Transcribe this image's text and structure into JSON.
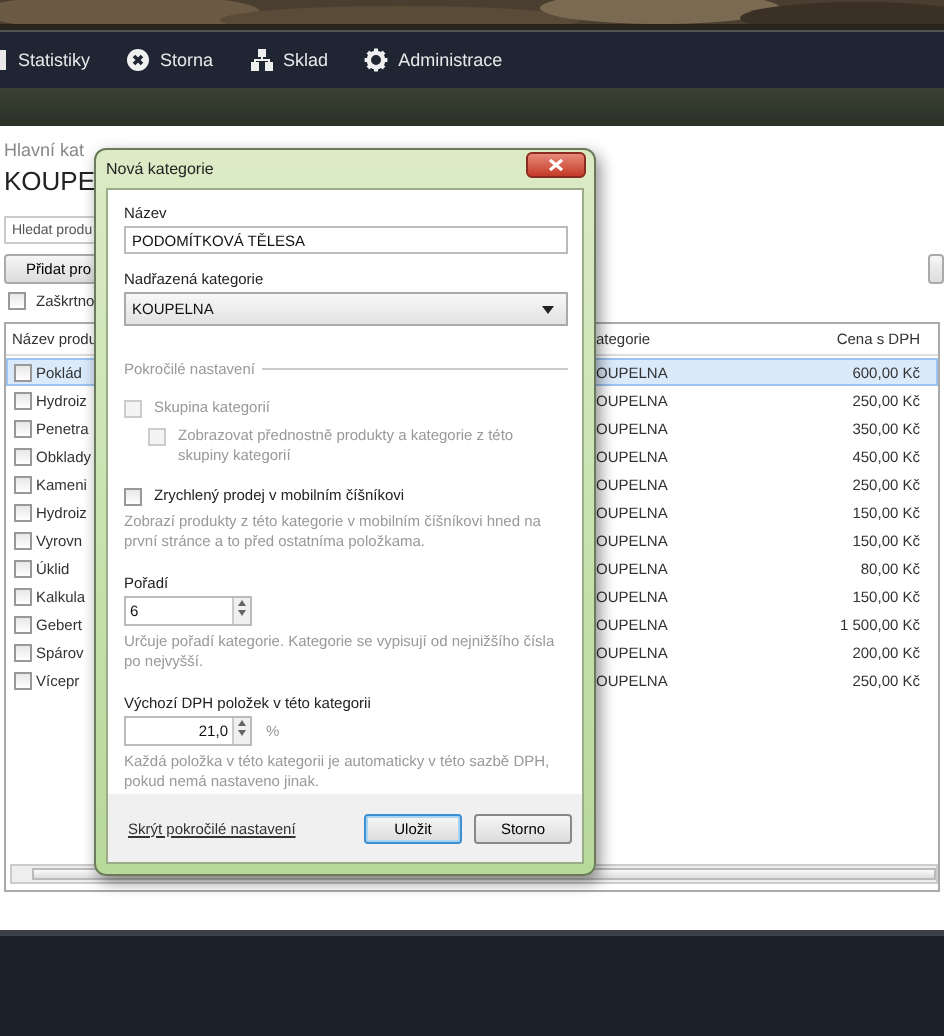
{
  "nav": {
    "items": [
      {
        "label": "Statistiky",
        "kind": "chart"
      },
      {
        "label": "Storna",
        "kind": "cancel"
      },
      {
        "label": "Sklad",
        "kind": "boxes"
      },
      {
        "label": "Administrace",
        "kind": "gear"
      }
    ]
  },
  "breadcrumb": "Hlavní kat",
  "heading": "KOUPE",
  "search": {
    "placeholder": "Hledat produ"
  },
  "add_button": "Přidat pro",
  "check_all": {
    "label": "Zaškrtno",
    "checked": false
  },
  "table": {
    "columns": [
      "Název produ",
      "ategorie",
      "Cena s DPH"
    ],
    "rows": [
      {
        "name": "Poklád",
        "category": "OUPELNA",
        "price": "600,00 Kč",
        "selected": true,
        "checked": false
      },
      {
        "name": "Hydroiz",
        "category": "OUPELNA",
        "price": "250,00 Kč",
        "selected": false,
        "checked": false
      },
      {
        "name": "Penetra",
        "category": "OUPELNA",
        "price": "350,00 Kč",
        "selected": false,
        "checked": false
      },
      {
        "name": "Obklady",
        "category": "OUPELNA",
        "price": "450,00 Kč",
        "selected": false,
        "checked": false
      },
      {
        "name": "Kameni",
        "category": "OUPELNA",
        "price": "250,00 Kč",
        "selected": false,
        "checked": false
      },
      {
        "name": "Hydroiz",
        "category": "OUPELNA",
        "price": "150,00 Kč",
        "selected": false,
        "checked": false
      },
      {
        "name": "Vyrovn",
        "category": "OUPELNA",
        "price": "150,00 Kč",
        "selected": false,
        "checked": false
      },
      {
        "name": "Úklid",
        "category": "OUPELNA",
        "price": "80,00 Kč",
        "selected": false,
        "checked": false
      },
      {
        "name": "Kalkula",
        "category": "OUPELNA",
        "price": "150,00 Kč",
        "selected": false,
        "checked": false
      },
      {
        "name": "Gebert",
        "category": "OUPELNA",
        "price": "1 500,00 Kč",
        "selected": false,
        "checked": false
      },
      {
        "name": "Spárov",
        "category": "OUPELNA",
        "price": "200,00 Kč",
        "selected": false,
        "checked": false
      },
      {
        "name": "Vícepr",
        "category": "OUPELNA",
        "price": "250,00 Kč",
        "selected": false,
        "checked": false
      }
    ]
  },
  "dialog": {
    "title": "Nová kategorie",
    "name_label": "Název",
    "name_value": "PODOMÍTKOVÁ TĚLESA",
    "parent_label": "Nadřazená kategorie",
    "parent_value": "KOUPELNA",
    "section": "Pokročilé nastavení",
    "options": [
      {
        "label": "Skupina kategorií",
        "checked": false,
        "disabled": true,
        "children": [
          {
            "label": "Zobrazovat přednostně produkty a kategorie z této skupiny kategorií",
            "checked": false,
            "disabled": true
          }
        ]
      },
      {
        "label": "Zrychlený prodej v mobilním číšníkovi",
        "checked": false,
        "disabled": false,
        "hint": "Zobrazí produkty z této kategorie v mobilním číšníkovi hned na první stránce a to před ostatníma položkama."
      }
    ],
    "order_label": "Pořadí",
    "order_value": "6",
    "order_hint": "Určuje pořadí kategorie. Kategorie se vypisují od nejnižšího čísla po nejvyšší.",
    "vat_label": "Výchozí DPH položek v této kategorii",
    "vat_value": "21,0",
    "vat_unit": "%",
    "vat_hint": "Každá položka v této kategorii je automaticky v této sazbě DPH, pokud nemá nastaveno jinak.",
    "link": "Skrýt pokročilé nastavení",
    "save": "Uložit",
    "cancel": "Storno"
  }
}
